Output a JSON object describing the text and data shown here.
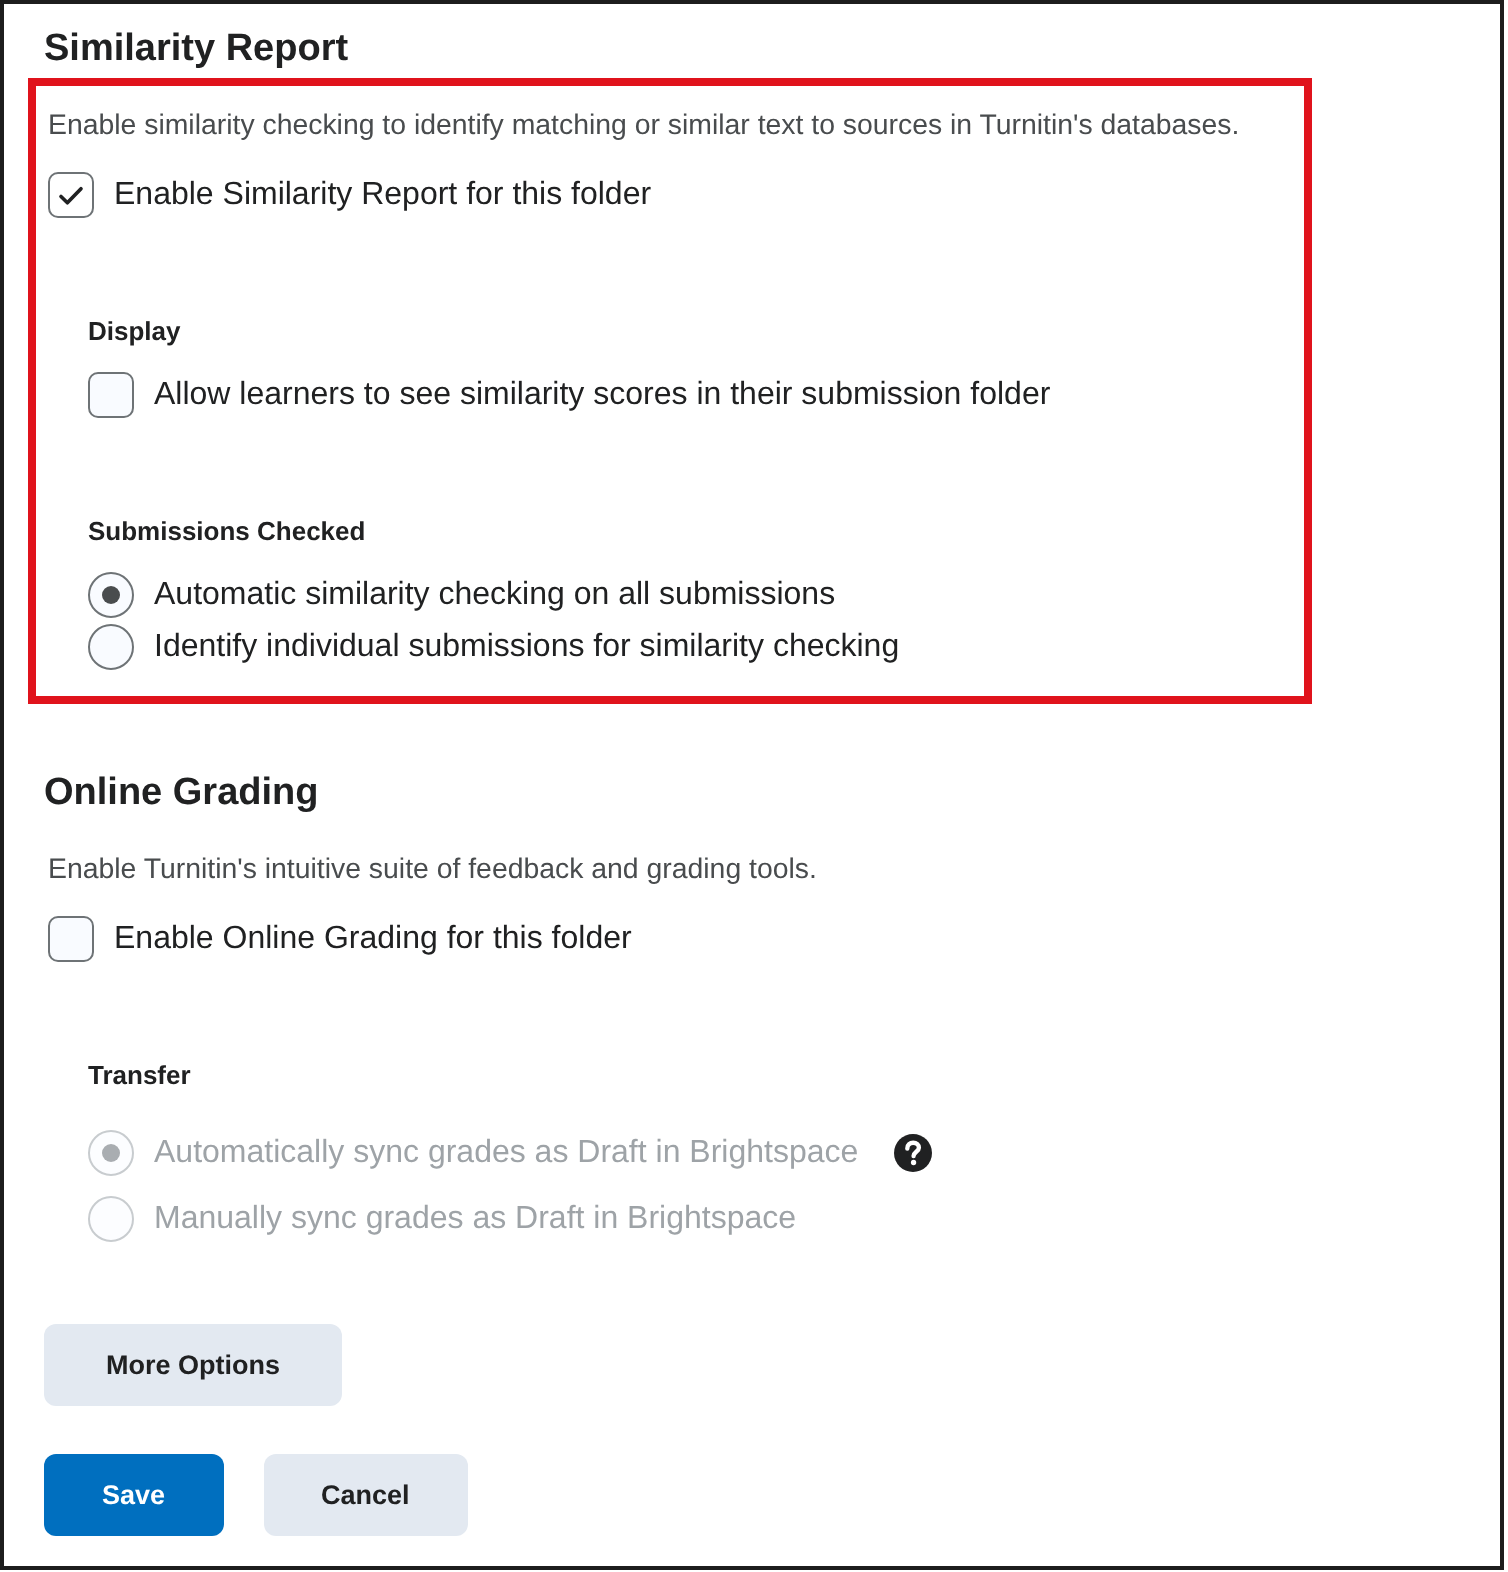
{
  "sections": [
    {
      "title": "Similarity Report",
      "highlighted": true,
      "description": "Enable similarity checking to identify matching or similar text to sources in Turnitin's databases.",
      "enable": {
        "label": "Enable Similarity Report for this folder",
        "checked": true
      },
      "groups": [
        {
          "label": "Display",
          "kind": "checkbox",
          "disabled": false,
          "options": [
            {
              "label": "Allow learners to see similarity scores in their submission folder",
              "checked": false
            }
          ]
        },
        {
          "label": "Submissions Checked",
          "kind": "radio",
          "disabled": false,
          "options": [
            {
              "label": "Automatic similarity checking on all submissions",
              "selected": true
            },
            {
              "label": "Identify individual submissions for similarity checking",
              "selected": false
            }
          ]
        }
      ]
    },
    {
      "title": "Online Grading",
      "description": "Enable Turnitin's intuitive suite of feedback and grading tools.",
      "enable": {
        "label": "Enable Online Grading for this folder",
        "checked": false
      },
      "groups": [
        {
          "label": "Transfer",
          "kind": "radio",
          "disabled": true,
          "options": [
            {
              "label": "Automatically sync grades as Draft in Brightspace",
              "selected": true,
              "help": true
            },
            {
              "label": "Manually sync grades as Draft in Brightspace",
              "selected": false
            }
          ]
        }
      ]
    }
  ],
  "more_options_button": "More Options",
  "buttons": [
    {
      "label": "Save",
      "kind": "primary"
    },
    {
      "label": "Cancel",
      "kind": "secondary"
    }
  ]
}
